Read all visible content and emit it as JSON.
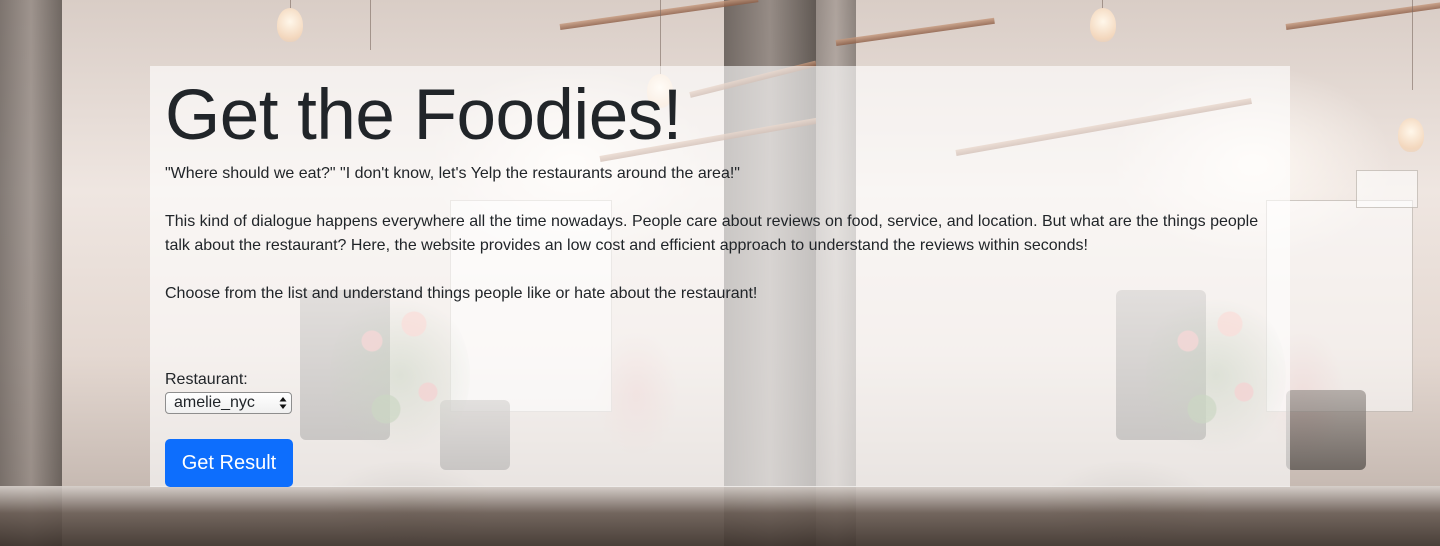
{
  "hero": {
    "title": "Get the Foodies!",
    "paragraphs": [
      "\"Where should we eat?\" \"I don't know, let's Yelp the restaurants around the area!\"",
      "This kind of dialogue happens everywhere all the time nowadays. People care about reviews on food, service, and location. But what are the things people talk about the restaurant? Here, the website provides an low cost and efficient approach to understand the reviews within seconds!",
      "Choose from the list and understand things people like or hate about the restaurant!"
    ]
  },
  "form": {
    "restaurant_label": "Restaurant:",
    "restaurant_selected": "amelie_nyc",
    "submit_label": "Get Result"
  },
  "colors": {
    "primary": "#0d6efd",
    "overlay": "rgba(255,255,255,0.62)",
    "text": "#212529"
  },
  "icons": {
    "select_arrows": "chevron-updown-icon"
  }
}
